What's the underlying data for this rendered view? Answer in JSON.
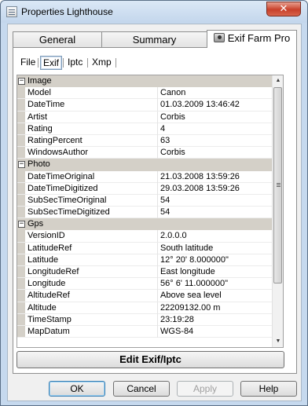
{
  "window": {
    "title": "Properties Lighthouse",
    "close_glyph": "✕"
  },
  "main_tabs": [
    {
      "label": "General"
    },
    {
      "label": "Summary"
    },
    {
      "label": "Exif Farm Pro",
      "icon": "camera-icon"
    }
  ],
  "sub_tabs": [
    {
      "label": "File"
    },
    {
      "label": "Exif"
    },
    {
      "label": "Iptc"
    },
    {
      "label": "Xmp"
    }
  ],
  "grid": {
    "categories": [
      {
        "name": "Image",
        "toggle": "−",
        "rows": [
          {
            "name": "Model",
            "value": "Canon"
          },
          {
            "name": "DateTime",
            "value": "01.03.2009 13:46:42"
          },
          {
            "name": "Artist",
            "value": "Corbis"
          },
          {
            "name": "Rating",
            "value": "4"
          },
          {
            "name": "RatingPercent",
            "value": "63"
          },
          {
            "name": "WindowsAuthor",
            "value": "Corbis"
          }
        ]
      },
      {
        "name": "Photo",
        "toggle": "−",
        "rows": [
          {
            "name": "DateTimeOriginal",
            "value": "21.03.2008 13:59:26"
          },
          {
            "name": "DateTimeDigitized",
            "value": "29.03.2008 13:59:26"
          },
          {
            "name": "SubSecTimeOriginal",
            "value": "54"
          },
          {
            "name": "SubSecTimeDigitized",
            "value": "54"
          }
        ]
      },
      {
        "name": "Gps",
        "toggle": "−",
        "rows": [
          {
            "name": "VersionID",
            "value": "2.0.0.0"
          },
          {
            "name": "LatitudeRef",
            "value": "South latitude"
          },
          {
            "name": "Latitude",
            "value": "12° 20' 8.000000\""
          },
          {
            "name": "LongitudeRef",
            "value": "East longitude"
          },
          {
            "name": "Longitude",
            "value": "56° 6' 11.000000\""
          },
          {
            "name": "AltitudeRef",
            "value": "Above sea level"
          },
          {
            "name": "Altitude",
            "value": "22209132.00 m"
          },
          {
            "name": "TimeStamp",
            "value": "23:19:28"
          },
          {
            "name": "MapDatum",
            "value": "WGS-84"
          }
        ]
      }
    ]
  },
  "edit_button": "Edit Exif/Iptc",
  "buttons": {
    "ok": "OK",
    "cancel": "Cancel",
    "apply": "Apply",
    "help": "Help"
  }
}
